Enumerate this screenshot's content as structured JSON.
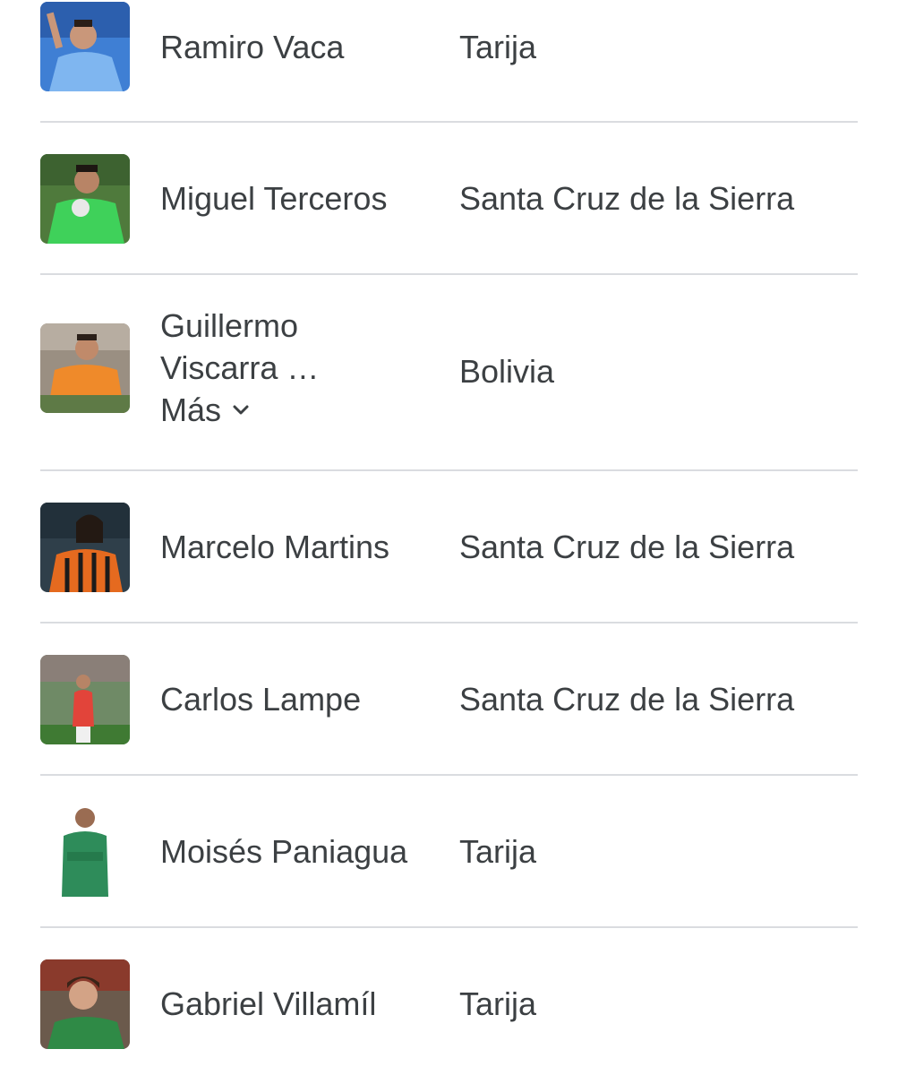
{
  "results": [
    {
      "name": "Ramiro Vaca",
      "place": "Tarija",
      "photo": "player-photo"
    },
    {
      "name": "Miguel Terceros",
      "place": "Santa Cruz de la Sierra",
      "photo": "player-photo"
    },
    {
      "name_line1": "Guillermo",
      "name_line2": "Viscarra …",
      "more_label": "Más",
      "place": "Bolivia",
      "photo": "player-photo"
    },
    {
      "name": "Marcelo Martins",
      "place": "Santa Cruz de la Sierra",
      "photo": "player-photo"
    },
    {
      "name": "Carlos Lampe",
      "place": "Santa Cruz de la Sierra",
      "photo": "player-photo"
    },
    {
      "name": "Moisés Paniagua",
      "place": "Tarija",
      "photo": "player-photo"
    },
    {
      "name": "Gabriel Villamíl",
      "place": "Tarija",
      "photo": "player-photo"
    }
  ],
  "colors": {
    "text": "#3c4043",
    "divider": "#dadce0"
  },
  "icons": {
    "more": "chevron-down-icon"
  }
}
